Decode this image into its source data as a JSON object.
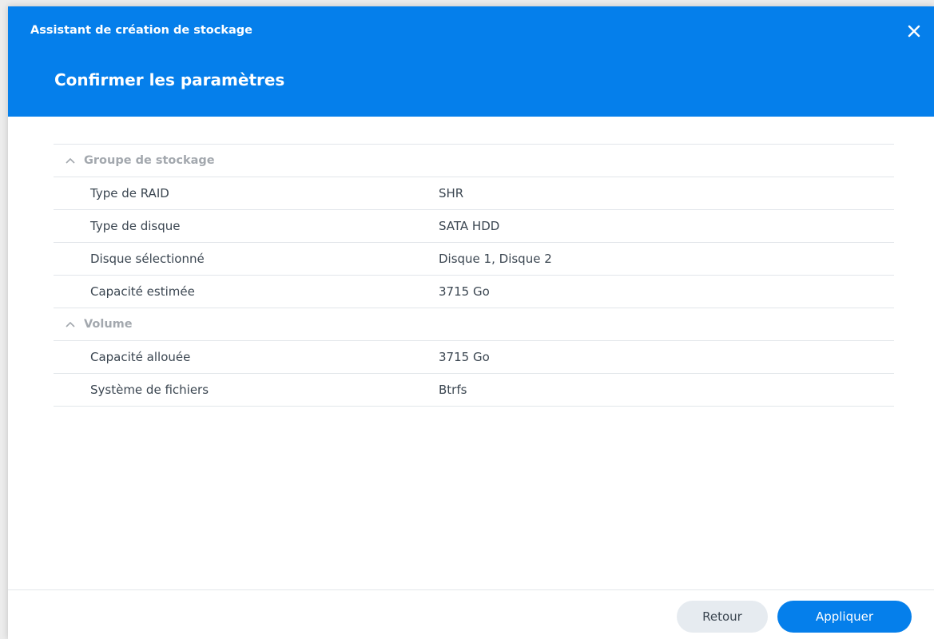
{
  "dialog": {
    "wizard_title": "Assistant de création de stockage",
    "step_title": "Confirmer les paramètres",
    "close_icon": "close-icon",
    "accent_color": "#057feb"
  },
  "sections": [
    {
      "title": "Groupe de stockage",
      "rows": [
        {
          "label": "Type de RAID",
          "value": "SHR"
        },
        {
          "label": "Type de disque",
          "value": "SATA HDD"
        },
        {
          "label": "Disque sélectionné",
          "value": "Disque 1, Disque 2"
        },
        {
          "label": "Capacité estimée",
          "value": "3715 Go"
        }
      ]
    },
    {
      "title": "Volume",
      "rows": [
        {
          "label": "Capacité allouée",
          "value": "3715 Go"
        },
        {
          "label": "Système de fichiers",
          "value": "Btrfs"
        }
      ]
    }
  ],
  "footer": {
    "back_label": "Retour",
    "apply_label": "Appliquer"
  }
}
